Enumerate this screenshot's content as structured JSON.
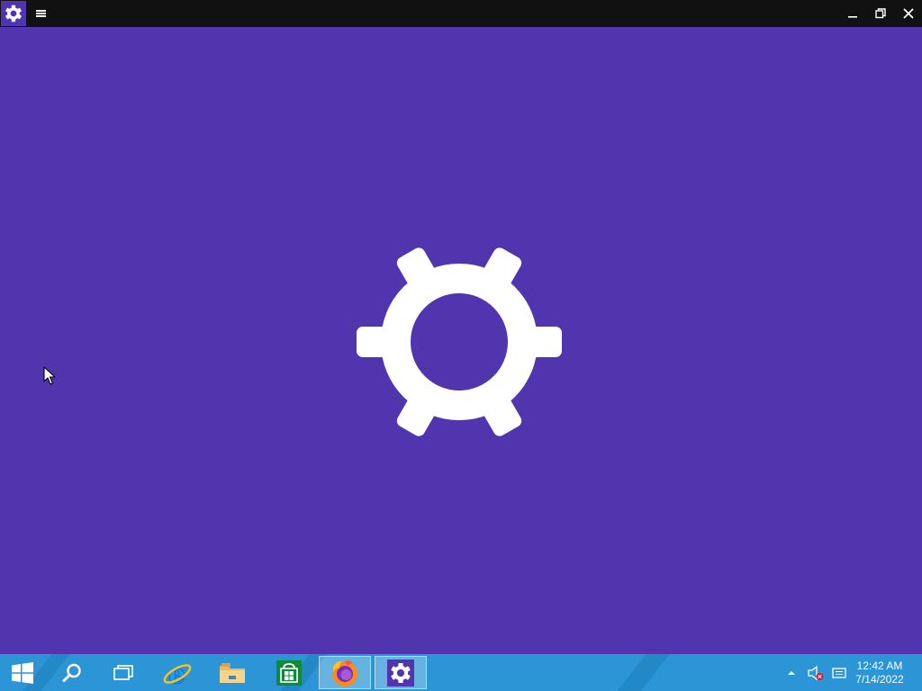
{
  "window": {
    "app_icon": "gear-icon",
    "menu_icon": "hamburger-menu-icon",
    "controls": [
      "minimize-icon",
      "restore-icon",
      "close-icon"
    ]
  },
  "splash": {
    "background": "#5035ae",
    "icon": "gear-icon"
  },
  "taskbar": {
    "background": "#2b95d6",
    "items": [
      "windows-start-icon",
      "search-icon",
      "task-view-icon",
      "internet-explorer-icon",
      "file-explorer-icon",
      "store-icon",
      "firefox-icon",
      "settings-gear-icon"
    ],
    "tray_icons": [
      "show-hidden-icons-chevron",
      "speaker-muted-icon",
      "action-center-icon"
    ],
    "clock": {
      "time": "12:42 AM",
      "date": "7/14/2022"
    }
  }
}
